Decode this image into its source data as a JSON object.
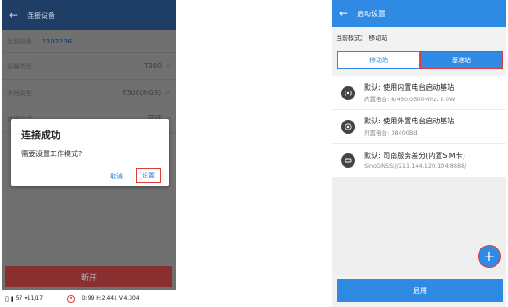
{
  "left": {
    "title": "连接设备",
    "device_label": "当前设备：",
    "device_value": "2107236",
    "rows": [
      {
        "label": "设备类型",
        "value": "T300",
        "chev": "∨"
      },
      {
        "label": "天线类型",
        "value": "T300(NGS)",
        "chev": ">"
      },
      {
        "label": "连接方式",
        "value": "蓝牙",
        "chev": "∨"
      }
    ],
    "dialog": {
      "title": "连接成功",
      "message": "需要设置工作模式?",
      "cancel": "取消",
      "ok": "设置"
    },
    "disconnect": "断开",
    "status": {
      "left": "57",
      "sat": "11/17",
      "right": "D:99 H:2.441 V:4.304"
    }
  },
  "right": {
    "title": "启动设置",
    "mode": "当前模式：  移动站",
    "tabs": [
      "移动站",
      "基准站"
    ],
    "items": [
      {
        "title": "默认: 使用内置电台启动基站",
        "subtitle": "内置电台: 6/460.0500MHz, 2.0W",
        "icon": "radio-icon"
      },
      {
        "title": "默认: 使用外置电台启动基站",
        "subtitle": "外置电台: 38400Bd",
        "icon": "antenna-icon"
      },
      {
        "title": "默认: 司南服务差分(内置SIM卡)",
        "subtitle": "SinoGNSS://211.144.120.104:8888/",
        "icon": "sim-card-icon"
      }
    ],
    "fab": "+",
    "enable": "启用"
  },
  "colors": {
    "left_header": "#1f3e66",
    "right_header": "#2f8ae3",
    "highlight": "#e03b3b",
    "disconnect": "#8a2f2f"
  }
}
